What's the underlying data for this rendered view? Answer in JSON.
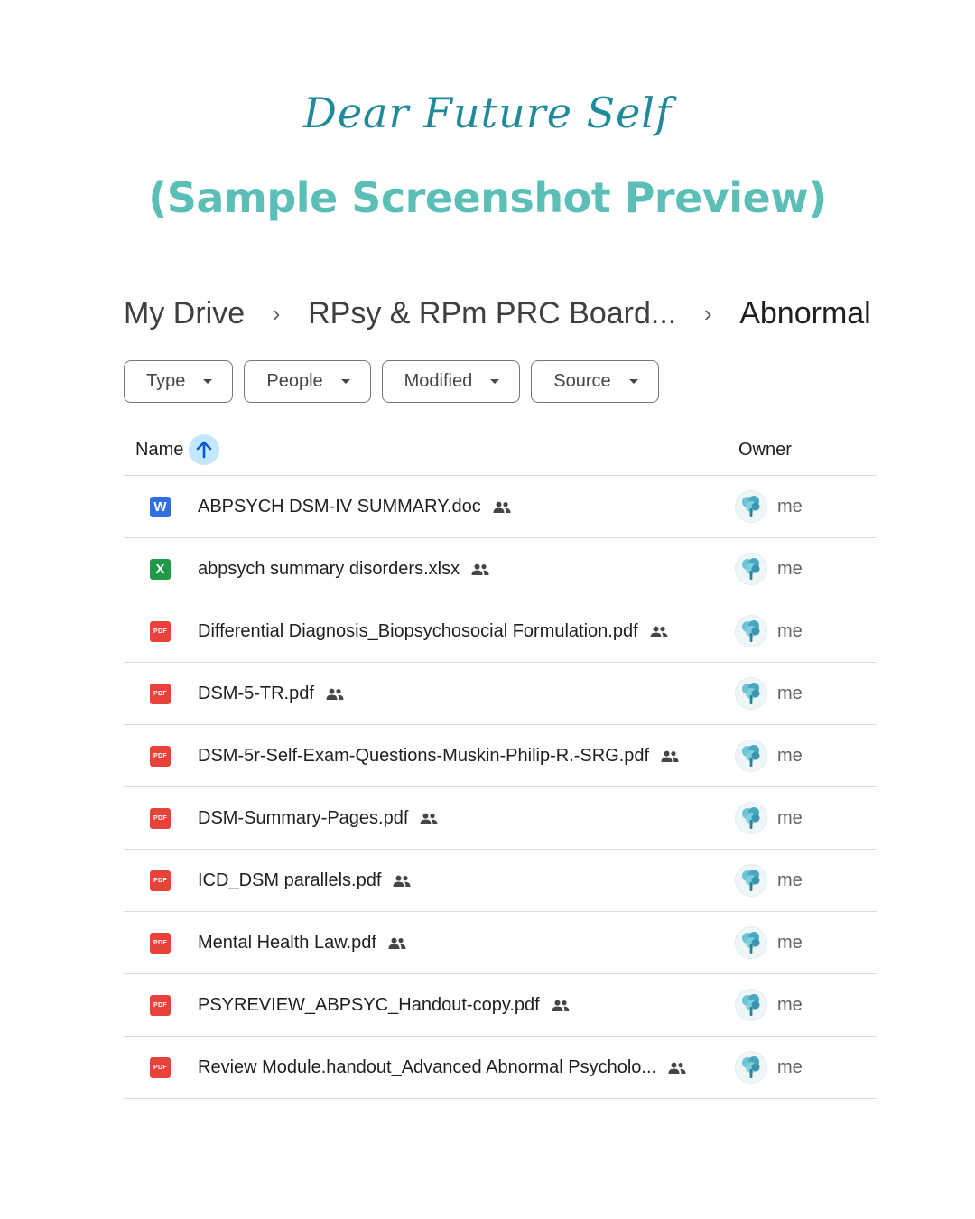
{
  "header": {
    "brand": "Dear Future Self",
    "subtitle": "(Sample Screenshot Preview)"
  },
  "breadcrumb": {
    "items": [
      "My Drive",
      "RPsy & RPm PRC Board...",
      "Abnormal"
    ],
    "separator": "›"
  },
  "filters": [
    "Type",
    "People",
    "Modified",
    "Source"
  ],
  "columns": {
    "name": "Name",
    "owner": "Owner",
    "sort": "ascending"
  },
  "files": [
    {
      "name": "ABPSYCH DSM-IV SUMMARY.doc",
      "type": "doc",
      "icon_label": "W",
      "owner": "me",
      "shared": true
    },
    {
      "name": "abpsych summary disorders.xlsx",
      "type": "xls",
      "icon_label": "X",
      "owner": "me",
      "shared": true
    },
    {
      "name": "Differential Diagnosis_Biopsychosocial Formulation.pdf",
      "type": "pdf",
      "icon_label": "PDF",
      "owner": "me",
      "shared": true
    },
    {
      "name": "DSM-5-TR.pdf",
      "type": "pdf",
      "icon_label": "PDF",
      "owner": "me",
      "shared": true
    },
    {
      "name": "DSM-5r-Self-Exam-Questions-Muskin-Philip-R.-SRG.pdf",
      "type": "pdf",
      "icon_label": "PDF",
      "owner": "me",
      "shared": true
    },
    {
      "name": "DSM-Summary-Pages.pdf",
      "type": "pdf",
      "icon_label": "PDF",
      "owner": "me",
      "shared": true
    },
    {
      "name": "ICD_DSM parallels.pdf",
      "type": "pdf",
      "icon_label": "PDF",
      "owner": "me",
      "shared": true
    },
    {
      "name": "Mental Health Law.pdf",
      "type": "pdf",
      "icon_label": "PDF",
      "owner": "me",
      "shared": true
    },
    {
      "name": "PSYREVIEW_ABPSYC_Handout-copy.pdf",
      "type": "pdf",
      "icon_label": "PDF",
      "owner": "me",
      "shared": true
    },
    {
      "name": "Review Module.handout_Advanced Abnormal Psycholo...",
      "type": "pdf",
      "icon_label": "PDF",
      "owner": "me",
      "shared": true
    }
  ],
  "colors": {
    "brand": "#1f8a9a",
    "subtitle": "#5bbfb8",
    "sort_bg": "#c2e7ff",
    "doc": "#2f6fe0",
    "xls": "#1e9a47",
    "pdf": "#e8433b"
  }
}
